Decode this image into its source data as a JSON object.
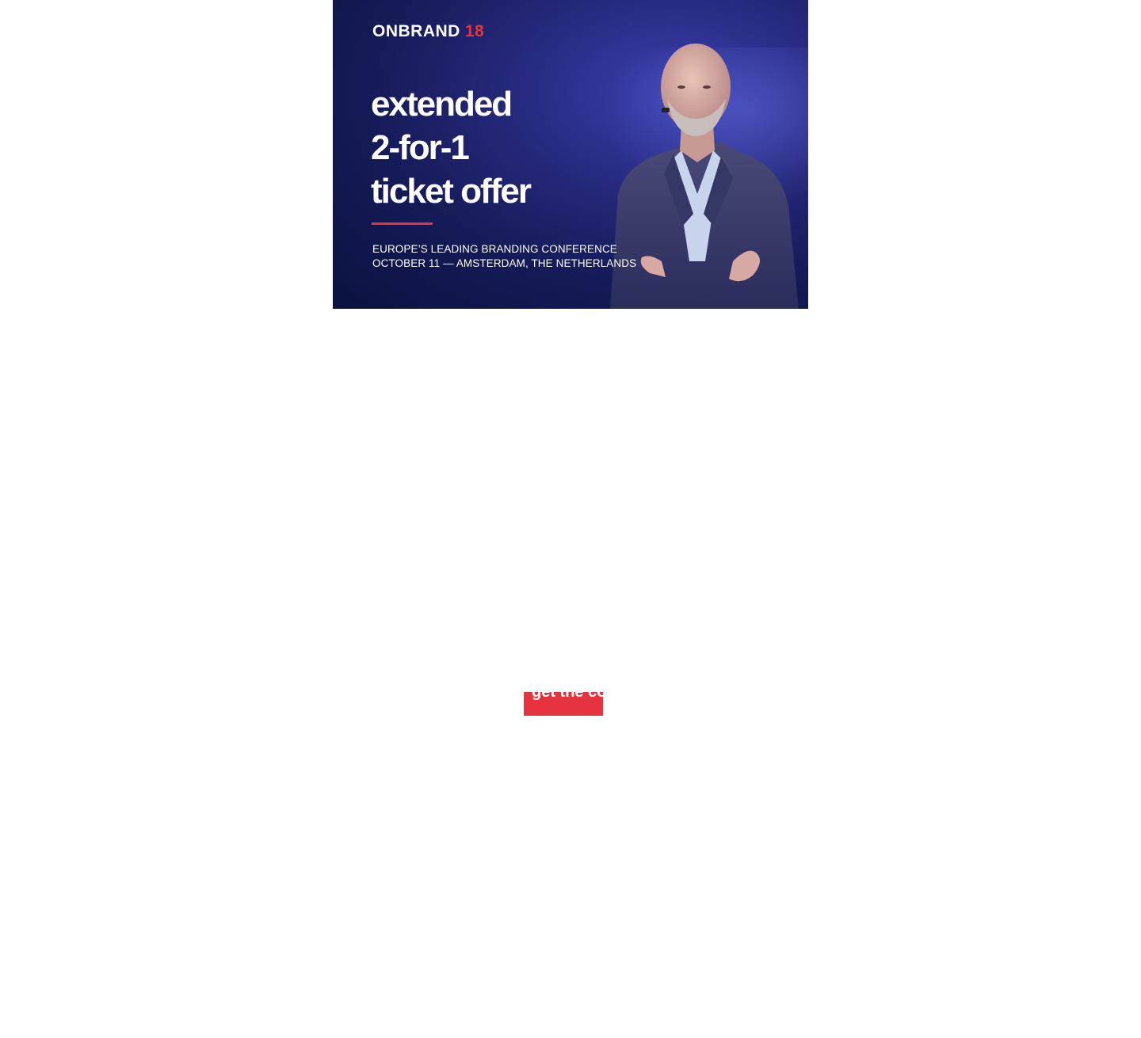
{
  "banner": {
    "logo_text": "ONBRAND",
    "logo_number": "18",
    "headline": [
      "extended",
      "2-for-1",
      "ticket offer"
    ],
    "tagline": "EUROPE’S LEADING BRANDING CONFERENCE",
    "event_details": "OCTOBER 11 — AMSTERDAM, THE NETHERLANDS",
    "accent_color": "#e5333f",
    "background_color": "#141a55"
  },
  "cta": {
    "label": "get the co"
  }
}
